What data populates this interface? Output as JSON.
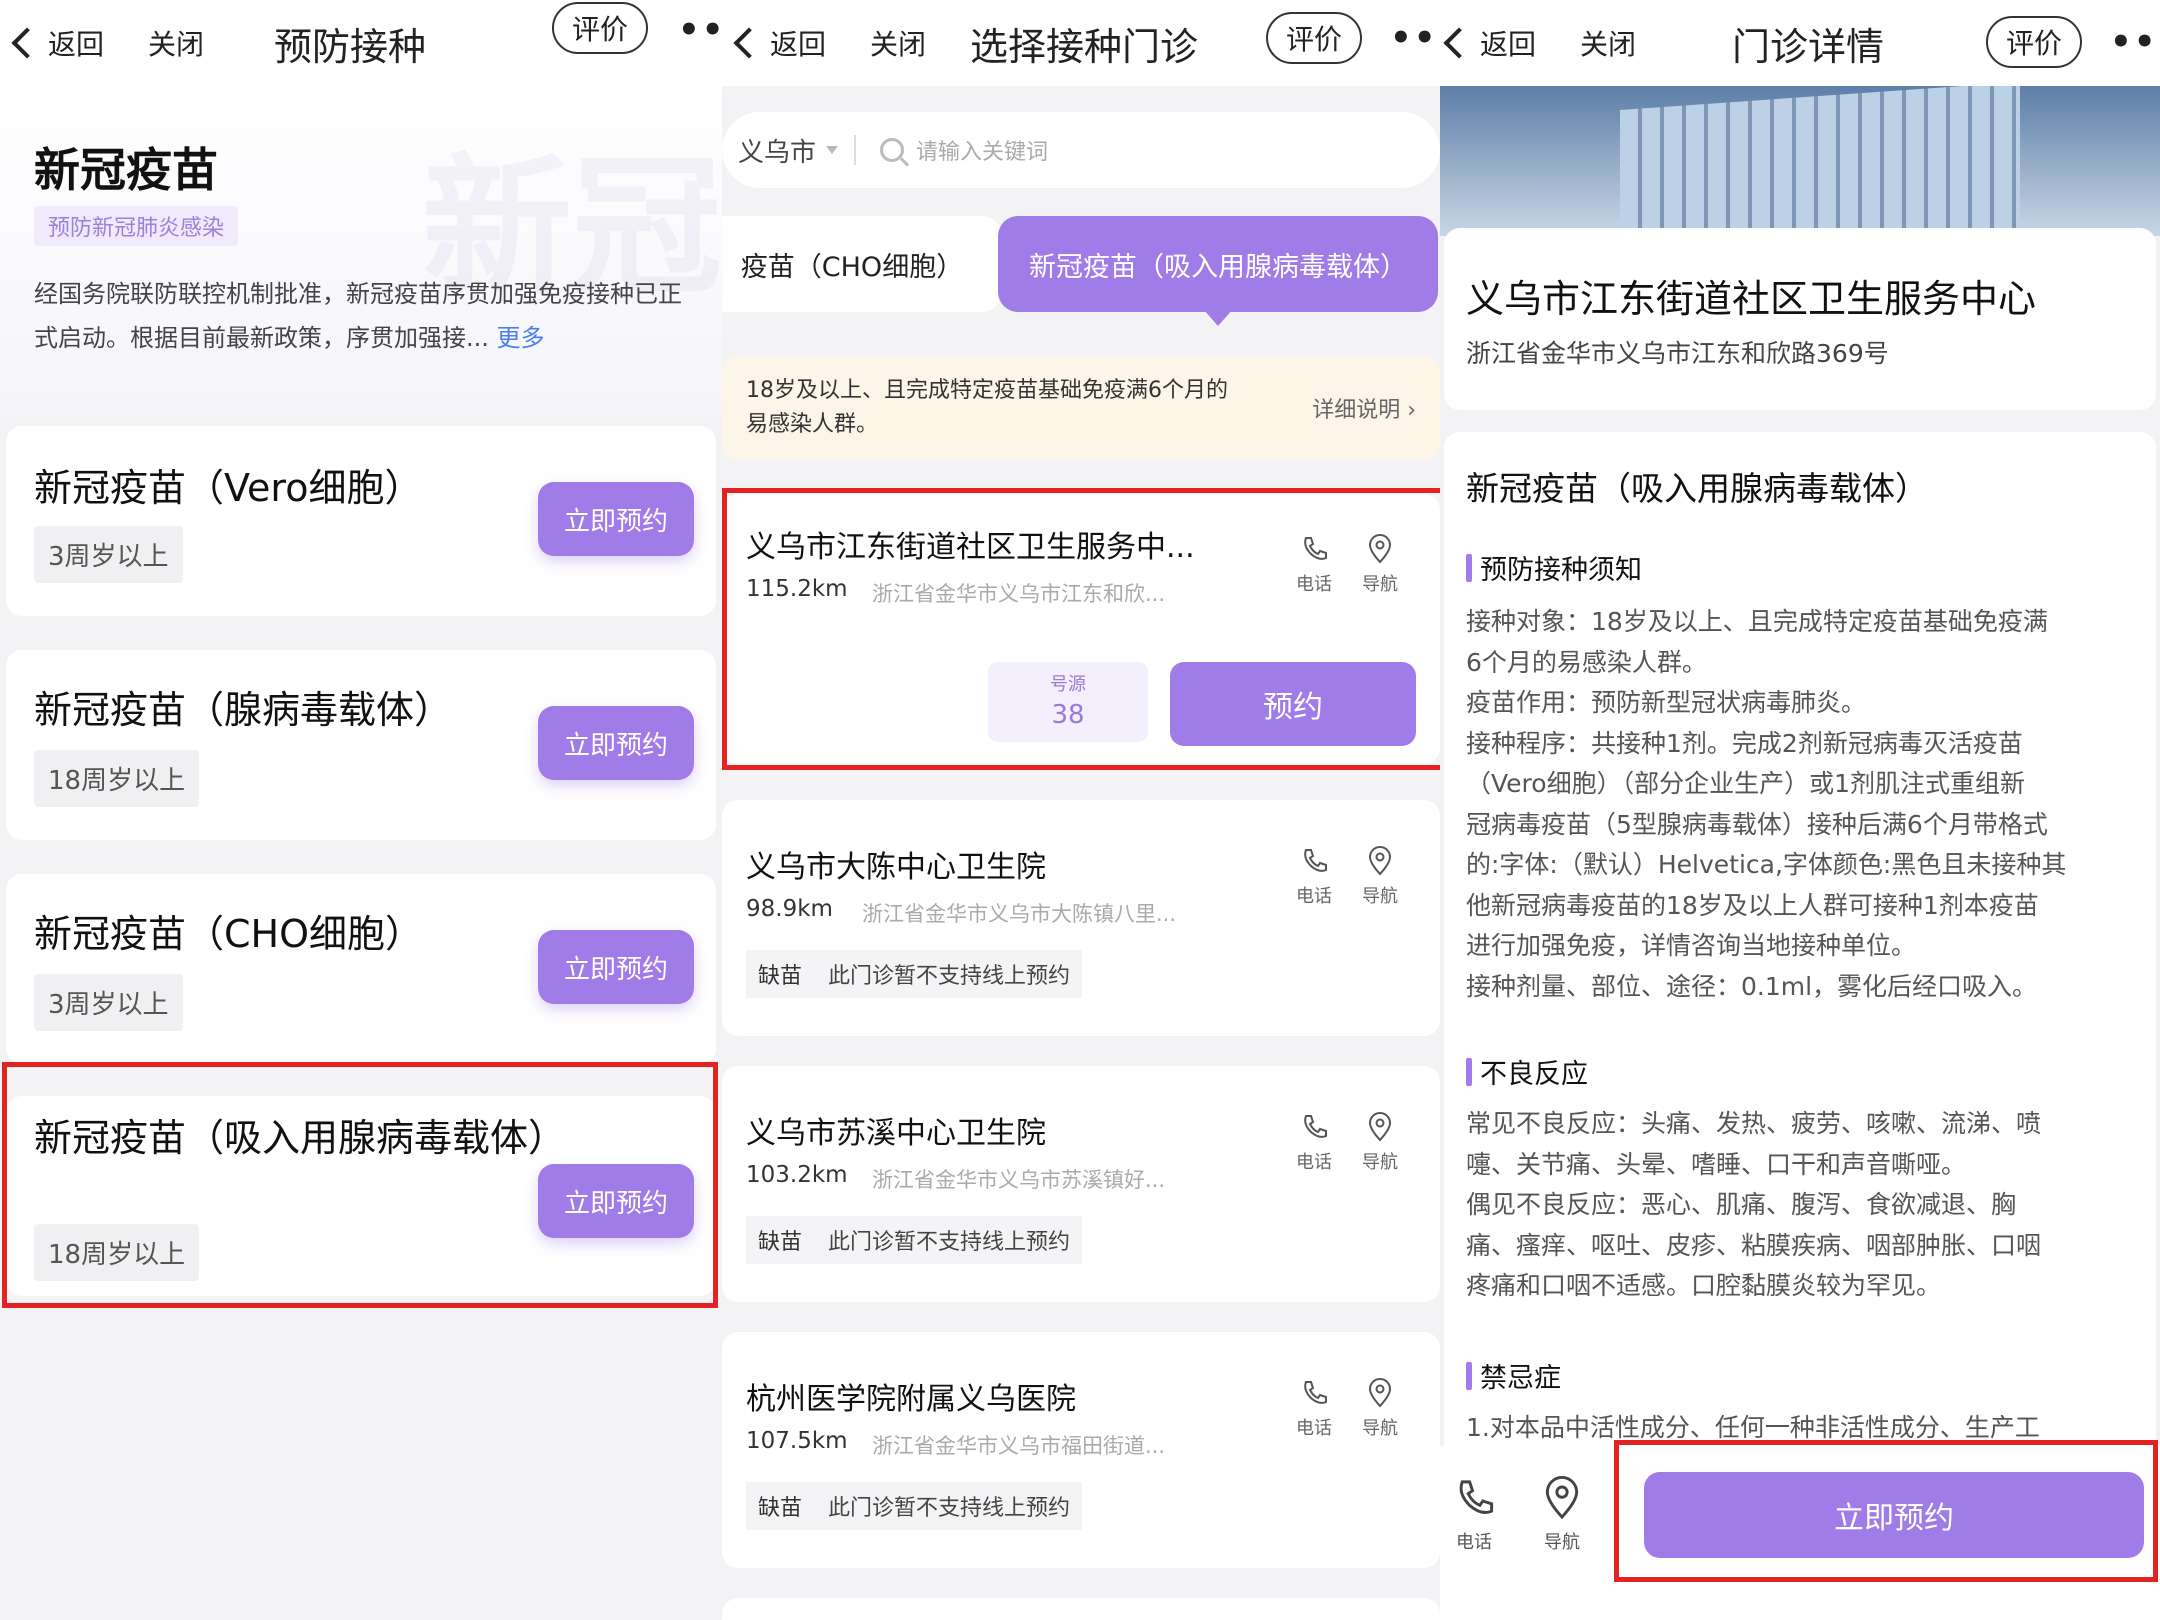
{
  "common": {
    "back_label": "返回",
    "close_label": "关闭",
    "rate_label": "评价",
    "more_label": "•••",
    "phone_label": "电话",
    "nav_label": "导航"
  },
  "screen1": {
    "title": "预防接种",
    "watermark": "新冠",
    "heading": "新冠疫苗",
    "tag": "预防新冠肺炎感染",
    "desc": "经国务院联防联控机制批准，新冠疫苗序贯加强免疫接种已正式启动。根据目前最新政策，序贯加强接...",
    "more_link": "更多",
    "book_label": "立即预约",
    "vaccines": [
      {
        "name": "新冠疫苗（Vero细胞）",
        "age": "3周岁以上"
      },
      {
        "name": "新冠疫苗（腺病毒载体）",
        "age": "18周岁以上"
      },
      {
        "name": "新冠疫苗（CHO细胞）",
        "age": "3周岁以上"
      },
      {
        "name": "新冠疫苗（吸入用腺病毒载体）",
        "age": "18周岁以上"
      }
    ]
  },
  "screen2": {
    "title": "选择接种门诊",
    "city": "义乌市",
    "search_placeholder": "请输入关键词",
    "tabs": [
      "疫苗（CHO细胞）",
      "新冠疫苗（吸入用腺病毒载体）"
    ],
    "notice_text": "18岁及以上、且完成特定疫苗基础免疫满6个月的易感染人群。",
    "notice_link": "详细说明 ›",
    "clinics": [
      {
        "name": "义乌市江东街道社区卫生服务中...",
        "distance": "115.2km",
        "address": "浙江省金华市义乌市江东和欣...",
        "quota_label": "号源",
        "quota_value": "38",
        "book_label": "预约"
      },
      {
        "name": "义乌市大陈中心卫生院",
        "distance": "98.9km",
        "address": "浙江省金华市义乌市大陈镇八里...",
        "status": "缺苗",
        "status_note": "此门诊暂不支持线上预约"
      },
      {
        "name": "义乌市苏溪中心卫生院",
        "distance": "103.2km",
        "address": "浙江省金华市义乌市苏溪镇好...",
        "status": "缺苗",
        "status_note": "此门诊暂不支持线上预约"
      },
      {
        "name": "杭州医学院附属义乌医院",
        "distance": "107.5km",
        "address": "浙江省金华市义乌市福田街道...",
        "status": "缺苗",
        "status_note": "此门诊暂不支持线上预约"
      }
    ]
  },
  "screen3": {
    "title": "门诊详情",
    "hospital_name": "义乌市江东街道社区卫生服务中心",
    "hospital_address": "浙江省金华市义乌市江东和欣路369号",
    "vaccine_title": "新冠疫苗（吸入用腺病毒载体）",
    "section1_title": "预防接种须知",
    "section1_lines": [
      "接种对象：18岁及以上、且完成特定疫苗基础免疫满",
      "6个月的易感染人群。",
      "疫苗作用：预防新型冠状病毒肺炎。",
      "接种程序：共接种1剂。完成2剂新冠病毒灭活疫苗",
      "（Vero细胞）（部分企业生产）或1剂肌注式重组新",
      "冠病毒疫苗（5型腺病毒载体）接种后满6个月带格式",
      "的:字体:（默认）Helvetica,字体颜色:黑色且未接种其",
      "他新冠病毒疫苗的18岁及以上人群可接种1剂本疫苗",
      "进行加强免疫，详情咨询当地接种单位。",
      "接种剂量、部位、途径：0.1ml，雾化后经口吸入。"
    ],
    "section2_title": "不良反应",
    "section2_lines": [
      "常见不良反应：头痛、发热、疲劳、咳嗽、流涕、喷",
      "嚏、关节痛、头晕、嗜睡、口干和声音嘶哑。",
      "偶见不良反应：恶心、肌痛、腹泻、食欲减退、胸",
      "痛、瘙痒、呕吐、皮疹、粘膜疾病、咽部肿胀、口咽",
      "疼痛和口咽不适感。口腔黏膜炎较为罕见。"
    ],
    "section3_title": "禁忌症",
    "section3_line": "1.对本品中活性成分、任何一种非活性成分、生产工",
    "book_label": "立即预约"
  }
}
